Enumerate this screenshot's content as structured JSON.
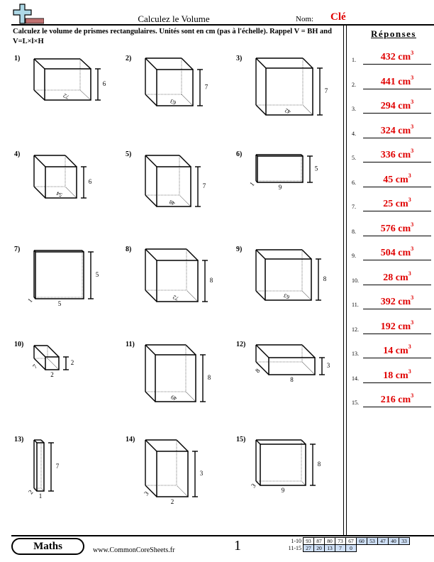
{
  "header": {
    "title": "Calculez le Volume",
    "name_label": "Nom:",
    "name_value": "Clé",
    "logo_icon": "plus-ruler-logo-icon"
  },
  "instructions": "Calculez le volume de prismes rectangulaires. Unités sont en cm (pas à l'échelle). Rappel V = BH and V=L×l×H",
  "answers": {
    "title": "Réponses",
    "unit": "cm",
    "items": [
      {
        "num": "1.",
        "value": "432"
      },
      {
        "num": "2.",
        "value": "441"
      },
      {
        "num": "3.",
        "value": "294"
      },
      {
        "num": "4.",
        "value": "324"
      },
      {
        "num": "5.",
        "value": "336"
      },
      {
        "num": "6.",
        "value": "45"
      },
      {
        "num": "7.",
        "value": "25"
      },
      {
        "num": "8.",
        "value": "576"
      },
      {
        "num": "9.",
        "value": "504"
      },
      {
        "num": "10.",
        "value": "28"
      },
      {
        "num": "11.",
        "value": "392"
      },
      {
        "num": "12.",
        "value": "192"
      },
      {
        "num": "13.",
        "value": "14"
      },
      {
        "num": "14.",
        "value": "18"
      },
      {
        "num": "15.",
        "value": "216"
      }
    ]
  },
  "problems": [
    {
      "num": "1)",
      "type": "base-area",
      "height": "6",
      "base_area": "72"
    },
    {
      "num": "2)",
      "type": "base-area",
      "height": "7",
      "base_area": "63"
    },
    {
      "num": "3)",
      "type": "base-area",
      "height": "7",
      "base_area": "42"
    },
    {
      "num": "4)",
      "type": "base-area",
      "height": "6",
      "base_area": "54"
    },
    {
      "num": "5)",
      "type": "base-area",
      "height": "7",
      "base_area": "48"
    },
    {
      "num": "6)",
      "type": "dimensions",
      "height": "5",
      "width": "9",
      "depth": "1"
    },
    {
      "num": "7)",
      "type": "dimensions",
      "height": "5",
      "width": "5",
      "depth": "1"
    },
    {
      "num": "8)",
      "type": "base-area",
      "height": "8",
      "base_area": "72"
    },
    {
      "num": "9)",
      "type": "base-area",
      "height": "8",
      "base_area": "63"
    },
    {
      "num": "10)",
      "type": "dimensions",
      "height": "2",
      "width": "2",
      "depth": "7"
    },
    {
      "num": "11)",
      "type": "base-area",
      "height": "8",
      "base_area": "49"
    },
    {
      "num": "12)",
      "type": "dimensions",
      "height": "3",
      "width": "8",
      "depth": "8"
    },
    {
      "num": "13)",
      "type": "dimensions",
      "height": "7",
      "width": "1",
      "depth": "2"
    },
    {
      "num": "14)",
      "type": "dimensions",
      "height": "3",
      "width": "2",
      "depth": "3"
    },
    {
      "num": "15)",
      "type": "dimensions",
      "height": "8",
      "width": "9",
      "depth": "3"
    }
  ],
  "footer": {
    "badge": "Maths",
    "site": "www.CommonCoreSheets.fr",
    "page": "1",
    "score_rows": [
      {
        "label": "1-10",
        "cells": [
          "93",
          "87",
          "80",
          "73",
          "67",
          "60",
          "53",
          "47",
          "40",
          "33"
        ]
      },
      {
        "label": "11-15",
        "cells": [
          "27",
          "20",
          "13",
          "7",
          "0"
        ]
      }
    ]
  },
  "colors": {
    "answer_red": "#e00000",
    "score_blue": "#cfe0f7",
    "logo_blue": "#add8e6",
    "logo_red": "#c07070"
  }
}
